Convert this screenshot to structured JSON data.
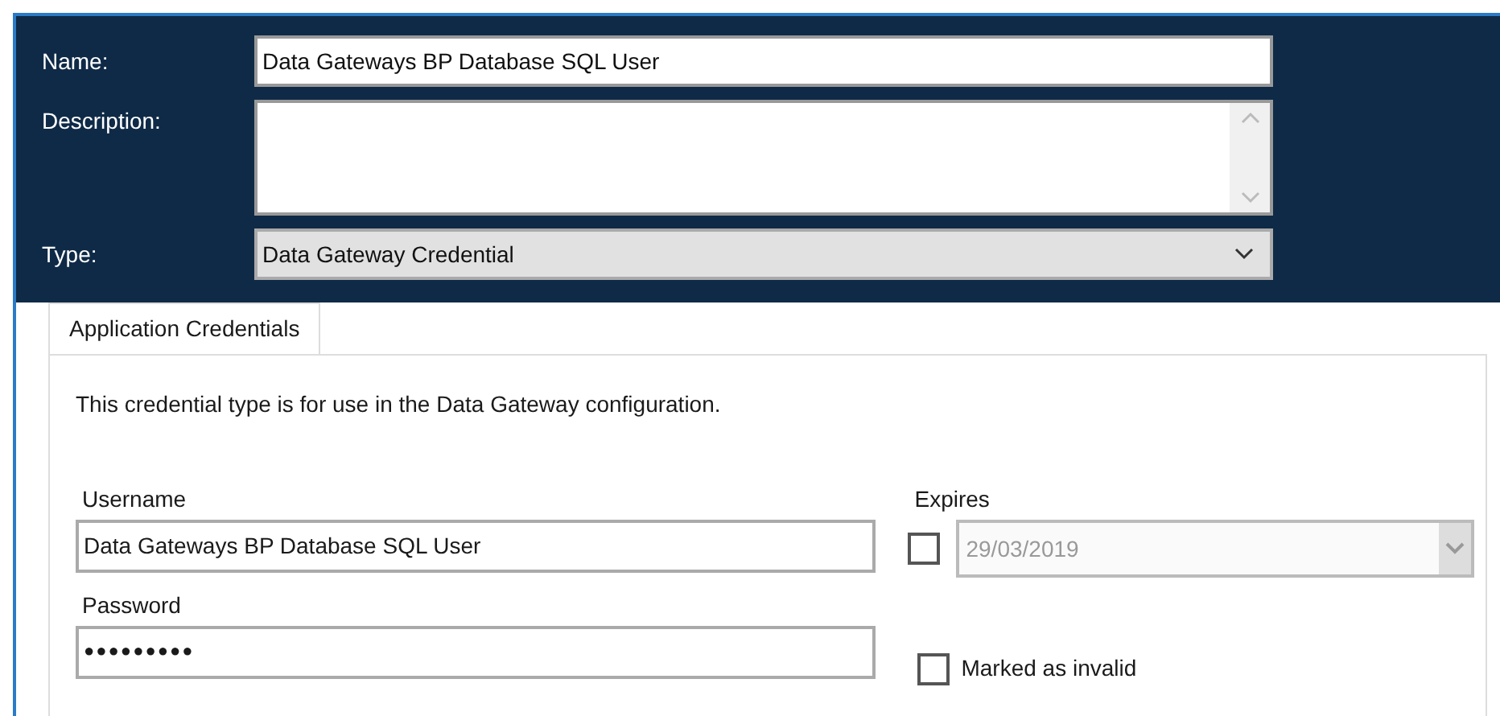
{
  "header": {
    "name": {
      "label": "Name:",
      "value": "Data Gateways BP Database SQL User"
    },
    "description": {
      "label": "Description:"
    },
    "type": {
      "label": "Type:",
      "value": "Data Gateway Credential"
    }
  },
  "tabs": [
    {
      "label": "Application Credentials",
      "selected": true
    }
  ],
  "info": "This credential type is for use in the Data Gateway configuration.",
  "username": {
    "label": "Username",
    "value": "Data Gateways BP Database SQL User"
  },
  "password": {
    "label": "Password",
    "value": "●●●●●●●●●"
  },
  "expires": {
    "label": "Expires",
    "checked": false,
    "date": "29/03/2019",
    "disabled": true
  },
  "marked_invalid": {
    "label": "Marked as invalid",
    "checked": false
  }
}
